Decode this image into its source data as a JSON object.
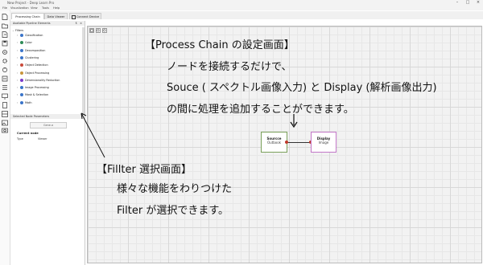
{
  "titlebar": {
    "title": "New Project - Deep Learn Pro"
  },
  "menu": [
    "File",
    "Visualization",
    "View",
    "Tools",
    "Help"
  ],
  "tabs": [
    {
      "label": "Processing Chain"
    },
    {
      "label": "Data Viewer"
    },
    {
      "label": "Connect Device"
    }
  ],
  "left_panel": {
    "header": "Available Pipeline Elements",
    "root": "Filters",
    "items": [
      {
        "label": "Classification",
        "color": "#3a74c9"
      },
      {
        "label": "Color",
        "color": "#2e8b57"
      },
      {
        "label": "Decomposition",
        "color": "#3a74c9"
      },
      {
        "label": "Clustering",
        "color": "#3a74c9"
      },
      {
        "label": "Object Detection",
        "color": "#c94a3a"
      },
      {
        "label": "Object Processing",
        "color": "#c9953a"
      },
      {
        "label": "Dimensionality Reduction",
        "color": "#7a3ac9"
      },
      {
        "label": "Image Processing",
        "color": "#3a74c9"
      },
      {
        "label": "Mask & Selection",
        "color": "#3a74c9"
      },
      {
        "label": "Math",
        "color": "#3a74c9"
      }
    ],
    "params_header": "Selected Node Parameters",
    "params_button": "Gene.a",
    "params_section": "Current node",
    "params_rows": [
      {
        "key": "Type",
        "value": "Viewer"
      }
    ]
  },
  "nodes": {
    "source": {
      "title": "Sourcce",
      "port": "Outbook"
    },
    "display": {
      "title": "Display",
      "port": "Image"
    }
  },
  "annotations": {
    "process_title": "【Process Chain の設定画面】",
    "process_line1": "ノードを接続するだけで、",
    "process_line2": "Souce ( スペクトル画像入力) と Display (解析画像出力)",
    "process_line3": "の間に処理を追加することができます。",
    "filter_title": "【Fillter 選択画面】",
    "filter_line1": "様々な機能をわりつけた",
    "filter_line2": "Filter が選択できます。"
  }
}
